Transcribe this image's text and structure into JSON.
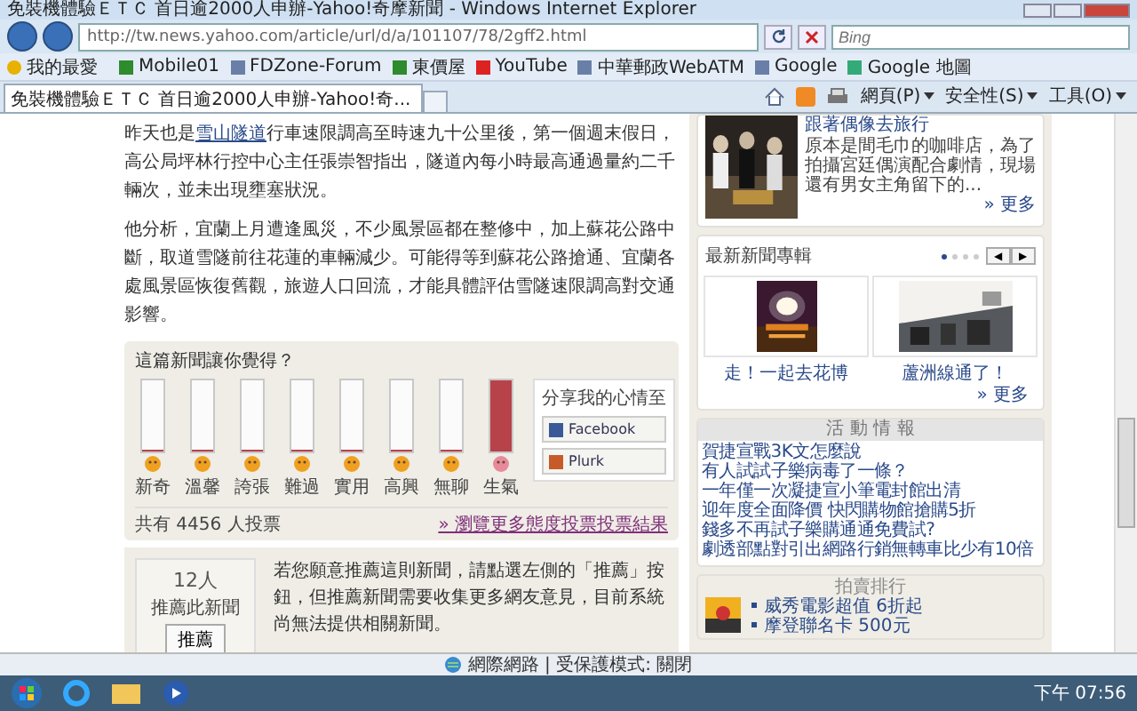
{
  "window": {
    "title": "免裝機體驗ＥＴＣ 首日逾2000人申辦-Yahoo!奇摩新聞 - Windows Internet Explorer"
  },
  "address_bar": {
    "url": "http://tw.news.yahoo.com/article/url/d/a/101107/78/2gff2.html"
  },
  "search": {
    "placeholder": "Bing"
  },
  "favorites": [
    {
      "label": "我的最愛",
      "kind": "star"
    },
    {
      "label": "Mobile01",
      "kind": "site"
    },
    {
      "label": "FDZone-Forum",
      "kind": "page"
    },
    {
      "label": "東價屋",
      "kind": "site"
    },
    {
      "label": "YouTube",
      "kind": "video"
    },
    {
      "label": "中華郵政WebATM",
      "kind": "page"
    },
    {
      "label": "Google",
      "kind": "page"
    },
    {
      "label": "Google 地圖",
      "kind": "map"
    }
  ],
  "tabs": [
    {
      "label": "免裝機體驗ＥＴＣ 首日逾2000人申辦-Yahoo!奇...",
      "selected": true
    }
  ],
  "command_bar": [
    "網頁(P)",
    "安全性(S)",
    "工具(O)"
  ],
  "article": {
    "paragraphs": [
      {
        "before": "昨天也是",
        "link": "雪山隧道",
        "after": "行車速限調高至時速九十公里後，第一個週末假日，高公局坪林行控中心主任張崇智指出，隧道內每小時最高通過量約二千輛次，並未出現壅塞狀況。"
      },
      {
        "before": "他分析，宜蘭上月遭逢風災，不少風景區都在整修中，加上蘇花公路中斷，取道雪隧前往花蓮的車輛減少。可能得等到蘇花公路搶通、宜蘭各處風景區恢復舊觀，旅遊人口回流，才能具體評估雪隧速限調高對交通影響。"
      }
    ]
  },
  "vote": {
    "title": "這篇新聞讓你覺得？",
    "options": [
      {
        "label": "新奇",
        "level": 0
      },
      {
        "label": "溫馨",
        "level": 0
      },
      {
        "label": "誇張",
        "level": 0
      },
      {
        "label": "難過",
        "level": 0
      },
      {
        "label": "實用",
        "level": 0
      },
      {
        "label": "高興",
        "level": 0
      },
      {
        "label": "無聊",
        "level": 0
      },
      {
        "label": "生氣",
        "level": 1
      }
    ],
    "share_title": "分享我的心情至",
    "share_buttons": [
      "Facebook",
      "Plurk"
    ],
    "total": "共有 4456 人投票",
    "more": "» 瀏覽更多態度投票投票結果"
  },
  "recommend": {
    "count": "12人",
    "label": "推薦此新聞",
    "button": "推薦",
    "text": "若您願意推薦這則新聞，請點選左側的「推薦」按鈕，但推薦新聞需要收集更多網友意見，目前系統尚無法提供相關新聞。"
  },
  "sidebar": {
    "feature": {
      "title": "跟著偶像去旅行",
      "text": "原本是間毛巾的咖啡店，為了拍攝宮廷偶演配合劇情，現場還有男女主角留下的...",
      "more": "» 更多"
    },
    "albums": {
      "title": "最新新聞專輯",
      "dots": [
        {
          "selected": true
        },
        {
          "selected": false
        },
        {
          "selected": false
        },
        {
          "selected": false
        }
      ],
      "prev": "◀",
      "next": "▶",
      "items": [
        "走！一起去花博",
        "蘆洲線通了！"
      ],
      "more": "» 更多"
    },
    "events": {
      "title": "活 動 情 報",
      "links": [
        "賀捷宣戰3K文怎麼說",
        "有人試試子樂病毒了一條？",
        "一年僅一次凝捷宣小筆電封館出清",
        "迎年度全面降價 快閃購物館搶購5折",
        "錢多不再試子樂購通通免費試?",
        "劇透部點對引出網路行銷無轉車比少有10倍"
      ]
    },
    "auction": {
      "title": "拍賣排行",
      "items": [
        "威秀電影超值 6折起",
        "摩登聯名卡 500元"
      ]
    }
  },
  "status_bar": {
    "zone": "網際網路 | 受保護模式: 關閉"
  },
  "taskbar": {
    "clock": "下午 07:56"
  }
}
